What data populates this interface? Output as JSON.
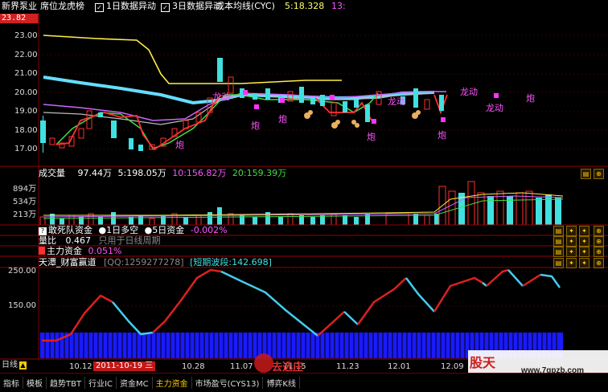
{
  "header": {
    "stock_name": "新界泵业",
    "indicator_name": "席位龙虎榜",
    "check1": "1日数据异动",
    "check2": "3日数据异动",
    "cyc_label": "成本均线(CYC)",
    "cyc_value": "5:18.328",
    "extra": "13:"
  },
  "price_axis": {
    "top_value": "23.82",
    "labels": [
      "23.00",
      "22.00",
      "21.00",
      "20.00",
      "19.00",
      "18.00",
      "17.00"
    ]
  },
  "annotations": {
    "pao": "炮",
    "longdong": "龙动"
  },
  "volume": {
    "title": "成交量",
    "value": "97.44万",
    "ma5": "5:198.05万",
    "ma10": "10:156.82万",
    "ma20": "20:159.39万",
    "axis": [
      "894万",
      "534万",
      "213万"
    ]
  },
  "panel_capital": {
    "label1": "敢死队资金",
    "label2": "1日多空",
    "label3": "5日资金",
    "value": "-0.002%"
  },
  "panel_volratio": {
    "label": "量比",
    "value": "0.467",
    "note": "只用于日线周期"
  },
  "panel_main": {
    "label": "主力资金",
    "value": "0.051%"
  },
  "panel_osc": {
    "title": "天潭_财富赢道",
    "qq": "[QQ:1259277278]",
    "wave": "[短期波段:142.698]",
    "axis": [
      "250.00",
      "150.00"
    ]
  },
  "dates": {
    "d1": "10.12",
    "selected": "2011-10-19 三",
    "d3": "10.28",
    "d4": "11.07",
    "d5": "11.15",
    "d6": "11.23",
    "d7": "12.01",
    "d8": "12.09"
  },
  "period": "日线",
  "bottom_tabs": [
    "指标",
    "模板",
    "趋势TBT",
    "行业IC",
    "资金MC",
    "主力资金",
    "市场盈亏(CYS13)",
    "博弈K线"
  ],
  "watermark": {
    "brand": "股天",
    "url": "www.7gpzb.com",
    "logo": "去选庄"
  },
  "colors": {
    "up": "#ff3030",
    "down": "#40e0e0",
    "accent": "#ffcc00"
  }
}
